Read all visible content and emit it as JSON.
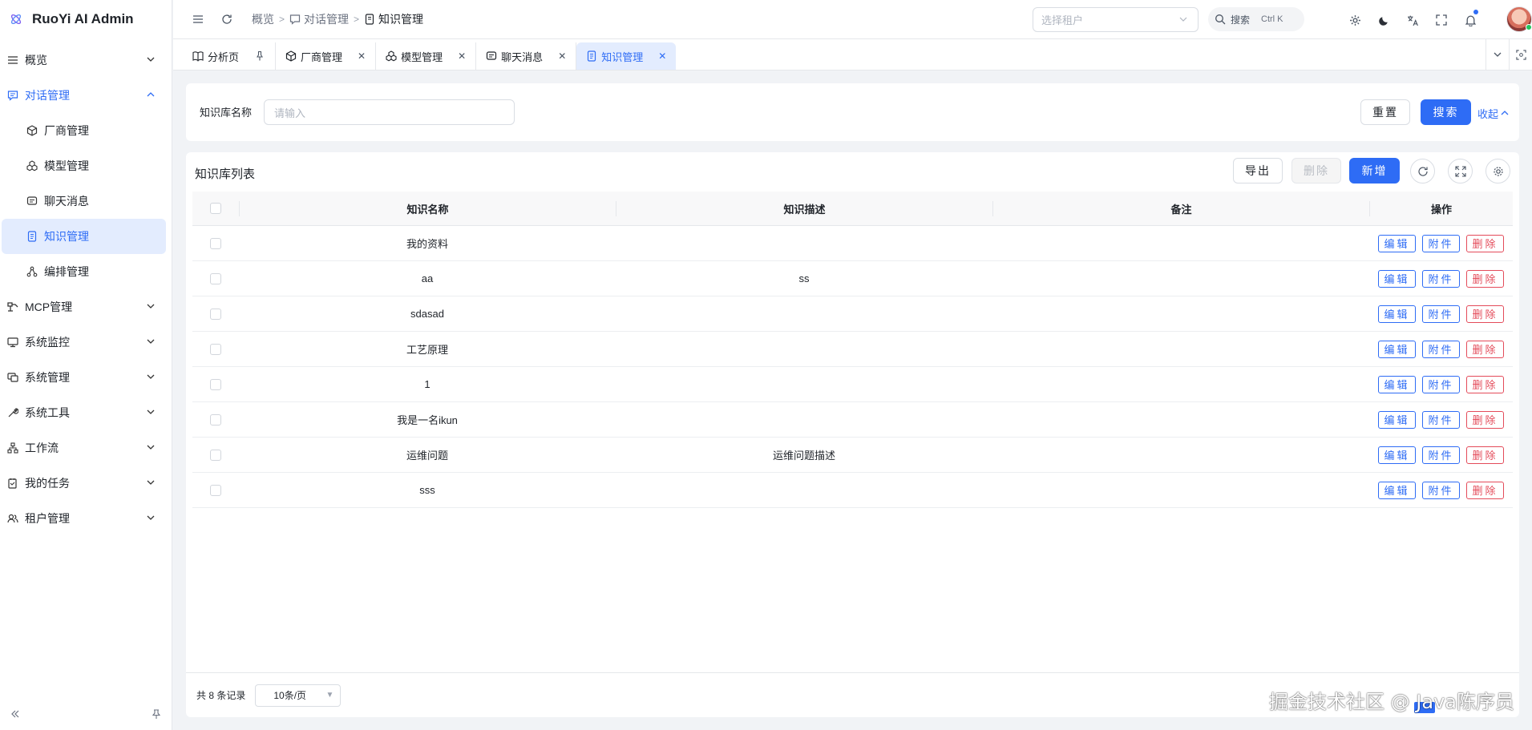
{
  "app": {
    "title": "RuoYi AI Admin"
  },
  "sidebar": {
    "items": [
      {
        "label": "概览",
        "icon": "list-icon",
        "expandable": true,
        "open": false
      },
      {
        "label": "对话管理",
        "icon": "chat-icon",
        "expandable": true,
        "open": true
      },
      {
        "label": "MCP管理",
        "icon": "mcp-icon",
        "expandable": true,
        "open": false
      },
      {
        "label": "系统监控",
        "icon": "monitor-icon",
        "expandable": true,
        "open": false
      },
      {
        "label": "系统管理",
        "icon": "system-icon",
        "expandable": true,
        "open": false
      },
      {
        "label": "系统工具",
        "icon": "tool-icon",
        "expandable": true,
        "open": false
      },
      {
        "label": "工作流",
        "icon": "workflow-icon",
        "expandable": true,
        "open": false
      },
      {
        "label": "我的任务",
        "icon": "task-icon",
        "expandable": true,
        "open": false
      },
      {
        "label": "租户管理",
        "icon": "tenant-icon",
        "expandable": true,
        "open": false
      }
    ],
    "submenu": [
      {
        "label": "厂商管理",
        "icon": "cube-icon",
        "active": false
      },
      {
        "label": "模型管理",
        "icon": "cubes-icon",
        "active": false
      },
      {
        "label": "聊天消息",
        "icon": "message-icon",
        "active": false
      },
      {
        "label": "知识管理",
        "icon": "document-icon",
        "active": true
      },
      {
        "label": "编排管理",
        "icon": "flow-icon",
        "active": false
      }
    ]
  },
  "header": {
    "breadcrumb": [
      "概览",
      "对话管理",
      "知识管理"
    ],
    "tenant_placeholder": "选择租户",
    "search_label": "搜索",
    "search_shortcut": "Ctrl K"
  },
  "tabs": [
    {
      "label": "分析页",
      "icon": "book-icon",
      "pinned": true,
      "active": false
    },
    {
      "label": "厂商管理",
      "icon": "cube-icon",
      "pinned": false,
      "active": false
    },
    {
      "label": "模型管理",
      "icon": "cubes-icon",
      "pinned": false,
      "active": false
    },
    {
      "label": "聊天消息",
      "icon": "message-icon",
      "pinned": false,
      "active": false
    },
    {
      "label": "知识管理",
      "icon": "document-icon",
      "pinned": false,
      "active": true
    }
  ],
  "search_form": {
    "label": "知识库名称",
    "placeholder": "请输入",
    "reset": "重置",
    "search": "搜索",
    "collapse": "收起"
  },
  "table": {
    "title": "知识库列表",
    "export": "导出",
    "delete": "删除",
    "add": "新增",
    "columns": [
      "知识名称",
      "知识描述",
      "备注",
      "操作"
    ],
    "rows": [
      {
        "name": "我的资料",
        "desc": "",
        "remark": ""
      },
      {
        "name": "aa",
        "desc": "ss",
        "remark": ""
      },
      {
        "name": "sdasad",
        "desc": "",
        "remark": ""
      },
      {
        "name": "工艺原理",
        "desc": "",
        "remark": ""
      },
      {
        "name": "1",
        "desc": "",
        "remark": ""
      },
      {
        "name": "我是一名ikun",
        "desc": "",
        "remark": ""
      },
      {
        "name": "运维问题",
        "desc": "运维问题描述",
        "remark": ""
      },
      {
        "name": "sss",
        "desc": "",
        "remark": ""
      }
    ],
    "row_actions": {
      "edit": "编辑",
      "attach": "附件",
      "delete": "删除"
    },
    "footer": {
      "total": "共 8 条记录",
      "page_size": "10条/页"
    }
  },
  "watermark": "掘金技术社区 @ Java陈序员",
  "colors": {
    "primary": "#2e6cf5",
    "danger": "#e44b5a",
    "active_bg": "#e3ecfe"
  }
}
